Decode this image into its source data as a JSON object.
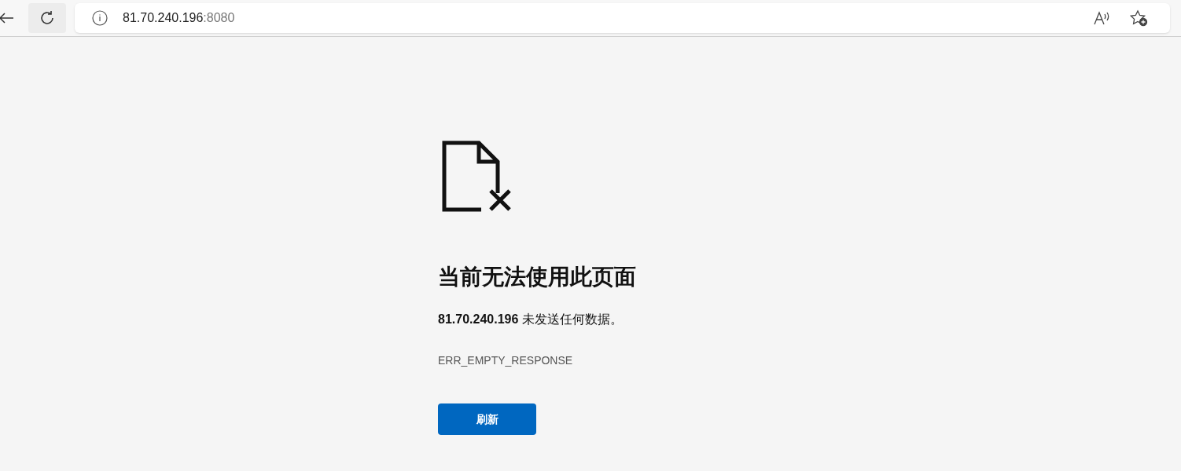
{
  "address_bar": {
    "host": "81.70.240.196",
    "port": ":8080"
  },
  "error": {
    "title": "当前无法使用此页面",
    "message": "**81.70.240.196** 未发送任何数据。",
    "code": "ERR_EMPTY_RESPONSE",
    "button": "刷新"
  }
}
